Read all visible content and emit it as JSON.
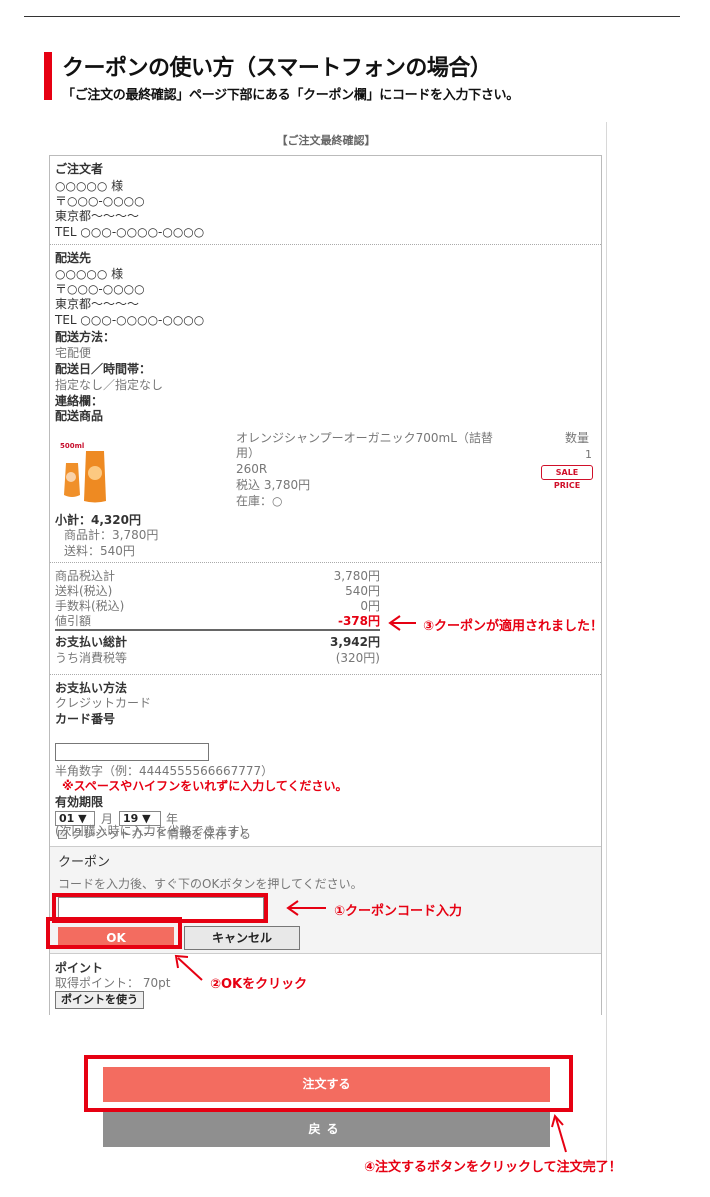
{
  "header": {
    "title": "クーポンの使い方（スマートフォンの場合）",
    "subtitle": "「ご注文の最終確認」ページ下部にある「クーポン欄」にコードを入力下さい。"
  },
  "screen": {
    "title": "【ご注文最終確認】",
    "orderer": {
      "label": "ご注文者",
      "name": "○○○○○ 様",
      "zip": "〒○○○-○○○○",
      "address": "東京都〜〜〜〜",
      "tel": "TEL ○○○-○○○○-○○○○"
    },
    "delivery": {
      "label": "配送先",
      "name": "○○○○○ 様",
      "zip": "〒○○○-○○○○",
      "address": "東京都〜〜〜〜",
      "tel": "TEL ○○○-○○○○-○○○○",
      "method_label": "配送方法：",
      "method_value": "宅配便",
      "date_label": "配送日／時間帯：",
      "date_value": "指定なし／指定なし",
      "memo_label": "連絡欄：",
      "items_label": "配送商品"
    },
    "product": {
      "image_text": "500ml",
      "name_line1": "オレンジシャンプーオーガニック700mL（詰替",
      "name_line2": "用）",
      "points": "260R",
      "price": "税込 3,780円",
      "stock": "在庫：○",
      "qty_label": "数量",
      "qty": "1",
      "badge": "SALE PRICE"
    },
    "subtotal": {
      "label": "小計：4,320円",
      "goods": "商品計：3,780円",
      "shipping": "送料：540円"
    },
    "summary": {
      "rows": [
        {
          "label": "商品税込計",
          "value": "3,780円"
        },
        {
          "label": "送料(税込)",
          "value": "540円"
        },
        {
          "label": "手数料(税込)",
          "value": "0円"
        },
        {
          "label": "値引額",
          "value": "-378円"
        }
      ],
      "total_label": "お支払い総計",
      "total_value": "3,942円",
      "tax_label": "うち消費税等",
      "tax_value": "(320円)"
    },
    "payment": {
      "label": "お支払い方法",
      "method": "クレジットカード",
      "card_label": "カード番号",
      "card_hint": "半角数字（例：4444555566667777）",
      "card_warning": "※スペースやハイフンをいれずに入力してください。",
      "expiry_label": "有効期限",
      "month": "01 ▼",
      "month_unit": "月",
      "year": "19 ▼",
      "year_unit": "年",
      "save_label": "クレジットカード情報を保存する",
      "save_note": "(次回購入時に入力を省略できます)"
    },
    "coupon": {
      "label": "クーポン",
      "instruction": "コードを入力後、すぐ下のOKボタンを押してください。",
      "ok": "OK",
      "cancel": "キャンセル"
    },
    "points_section": {
      "label": "ポイント",
      "earned": "取得ポイント： 70pt",
      "use_button": "ポイントを使う"
    },
    "submit": "注文する",
    "back": "戻る"
  },
  "annotations": {
    "note1": "①クーポンコード入力",
    "note2": "②OKをクリック",
    "note3": "③クーポンが適用されました！",
    "note4": "④注文するボタンをクリックして注文完了！"
  },
  "colors": {
    "accent_red": "#e60012",
    "button_salmon": "#f36c60",
    "button_gray": "#8f8f8f"
  }
}
